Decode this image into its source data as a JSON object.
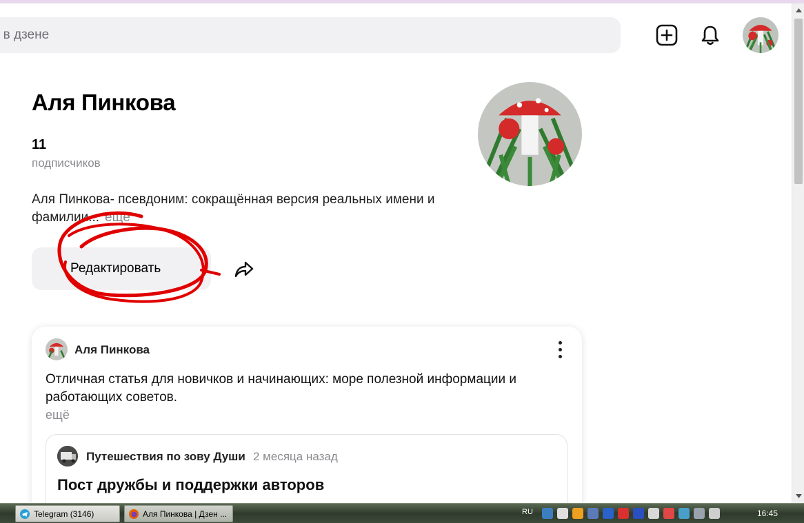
{
  "header": {
    "search_placeholder": "ти в дзене"
  },
  "profile": {
    "name": "Аля Пинкова",
    "subscribers_count": "11",
    "subscribers_label": "подписчиков",
    "bio": "Аля Пинкова- псевдоним: сокращённая версия реальных имени и фамилии...",
    "bio_more": "ещё",
    "edit_label": "Редактировать"
  },
  "post": {
    "author": "Аля Пинкова",
    "text": "Отличная статья для новичков и начинающих: море полезной информации и работающих советов.",
    "more": "ещё",
    "repost": {
      "channel": "Путешествия по зову Души",
      "time": "2 месяца назад",
      "title": "Пост дружбы и поддержки авторов"
    }
  },
  "taskbar": {
    "items": [
      {
        "label": "Telegram (3146)"
      },
      {
        "label": "Аля Пинкова | Дзен ..."
      }
    ],
    "language": "RU",
    "clock": "16:45"
  },
  "colors": {
    "accent_strip": "#e9d7f0",
    "annotation_red": "#e00000",
    "muted_text": "#8a8a8f"
  }
}
